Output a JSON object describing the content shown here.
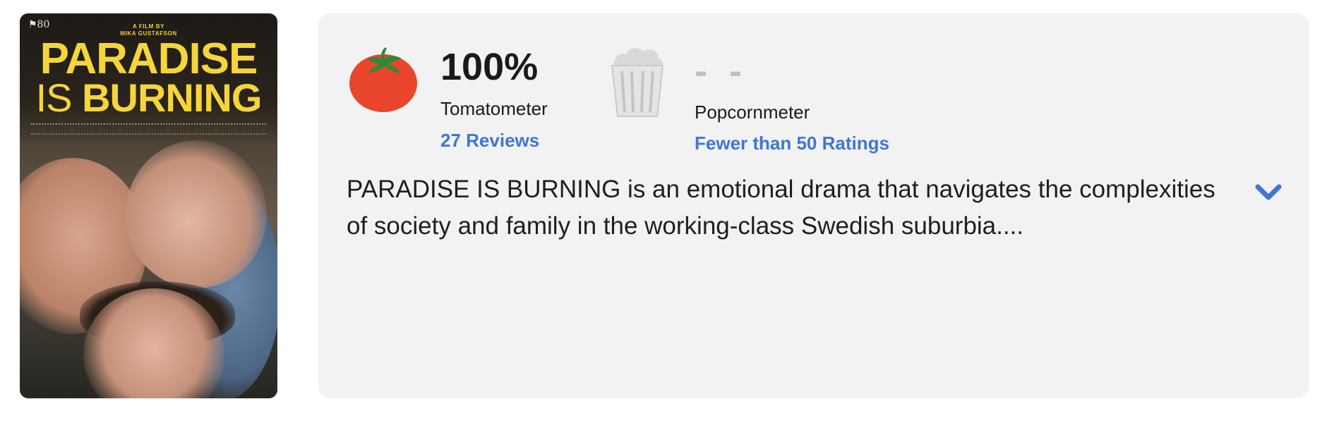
{
  "poster": {
    "fest_mark": "⚑80",
    "byline_line1": "A FILM BY",
    "byline_line2": "MIKA GUSTAFSON",
    "title_line1": "PARADISE",
    "title_line2a": "IS ",
    "title_line2b": "BURNING"
  },
  "tomatometer": {
    "score": "100%",
    "label": "Tomatometer",
    "reviews_link": "27 Reviews",
    "icon": "tomato-icon",
    "color": "#e8452c"
  },
  "popcornmeter": {
    "score": "- -",
    "label": "Popcornmeter",
    "ratings_link": "Fewer than 50 Ratings",
    "icon": "empty-popcorn-bucket-icon"
  },
  "synopsis": {
    "text": "PARADISE IS BURNING is an emotional drama that navigates the complexities of society and family in the working-class Swedish suburbia....",
    "expand_icon": "chevron-down-icon"
  },
  "colors": {
    "link": "#3f76d4",
    "card_bg": "#f2f2f2",
    "title_yellow": "#f6d53a"
  }
}
